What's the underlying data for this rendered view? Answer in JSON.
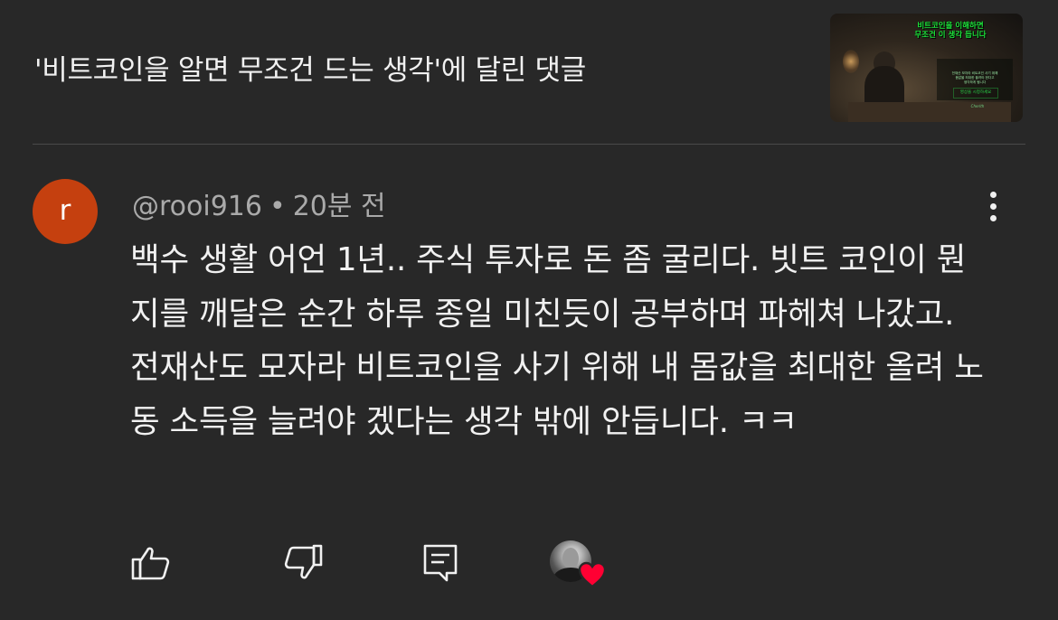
{
  "header": {
    "title": "'비트코인을 알면 무조건 드는 생각'에 달린 댓글"
  },
  "video_thumbnail": {
    "headline": "비트코인을 이해하면\n무조건 이 생각 듭니다",
    "caption": "전재산 모자라 비트코인 사기 위해\n몸값을 최대한 올려야 한다고\n생각하게 됩니다",
    "cta": "영상을 시청하세요",
    "signature": "Cherith"
  },
  "comment": {
    "avatar_letter": "r",
    "avatar_color": "#c5400f",
    "author": "@rooi916",
    "separator": "•",
    "timestamp": "20분 전",
    "text": "백수 생활 어언 1년.. 주식 투자로 돈 좀 굴리다. 빗트 코인이 뭔지를 깨달은 순간 하루 종일 미친듯이 공부하며 파헤쳐 나갔고. 전재산도 모자라 비트코인을 사기 위해 내 몸값을 최대한 올려 노동 소득을 늘려야 겠다는 생각 밖에 안듭니다.  ㅋㅋ"
  },
  "actions": {
    "like_icon": "thumbs-up-icon",
    "dislike_icon": "thumbs-down-icon",
    "reply_icon": "reply-icon",
    "creator_heart_icon": "heart-icon",
    "heart_color": "#ff0033"
  },
  "colors": {
    "background": "#282828",
    "text_primary": "#f1f1f1",
    "text_secondary": "#aaaaaa",
    "divider": "#4a4a4a"
  }
}
